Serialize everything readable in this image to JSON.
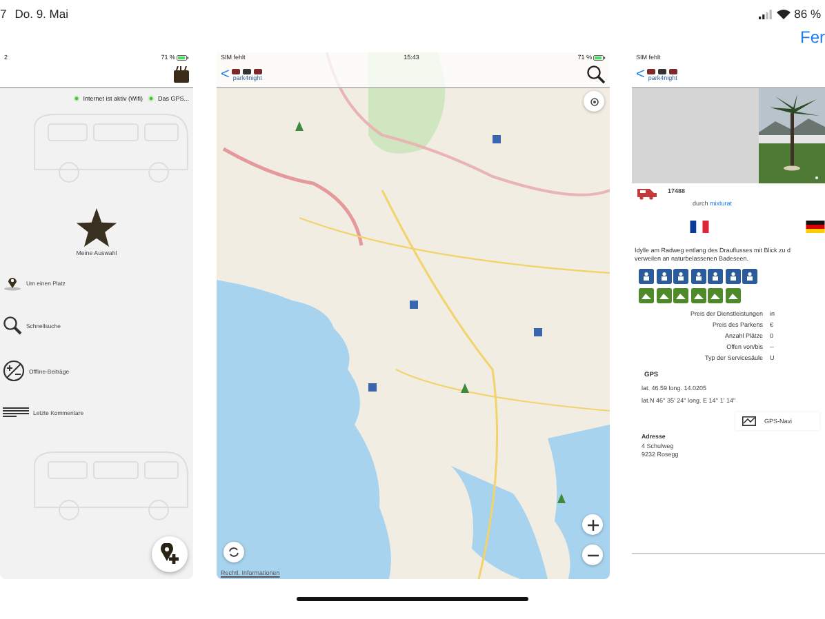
{
  "device_status": {
    "time": "7",
    "date": "Do. 9. Mai",
    "battery": "86 %"
  },
  "done_button": "Fer",
  "menu_screen": {
    "status": {
      "time": "2",
      "battery": "71 %"
    },
    "indicators": [
      {
        "label": "Internet ist aktiv (Wifi)",
        "on": true
      },
      {
        "label": "Das GPS...",
        "on": true
      }
    ],
    "favorite": "Meine Auswahl",
    "items": [
      {
        "kind": "nearby",
        "label": "Um einen Platz"
      },
      {
        "kind": "search",
        "label": "Schnellsuche"
      },
      {
        "kind": "offline",
        "label": "Offline-Beiträge"
      },
      {
        "kind": "comments",
        "label": "Letzte Kommentare"
      }
    ]
  },
  "map_screen": {
    "status": {
      "carrier": "SIM fehlt",
      "time": "15:43",
      "battery": "71 %"
    },
    "back_button": "<",
    "logo_text": "park4night",
    "legal_link": "Rechtl. Informationen"
  },
  "detail_screen": {
    "status": {
      "carrier": "SIM fehlt"
    },
    "back_button": "<",
    "logo_text": "park4night",
    "place_id": "17488",
    "author_prefix": "durch",
    "author": "mixturat",
    "languages": [
      {
        "kind": "fr"
      },
      {
        "kind": "de"
      }
    ],
    "description": [
      "Idylle am Radweg entlang des Drauflusses mit Blick zu d",
      "verweilen an naturbelassenen Badeseen."
    ],
    "services": [
      {
        "color": "#2b5c99"
      },
      {
        "color": "#2b5c99"
      },
      {
        "color": "#2b5c99"
      },
      {
        "color": "#2b5c99"
      },
      {
        "color": "#2b5c99"
      },
      {
        "color": "#2b5c99"
      },
      {
        "color": "#2b5c99"
      }
    ],
    "activities": [
      {
        "color": "#4f8a2a"
      },
      {
        "color": "#4f8a2a"
      },
      {
        "color": "#4f8a2a"
      },
      {
        "color": "#4f8a2a"
      },
      {
        "color": "#4f8a2a"
      },
      {
        "color": "#4f8a2a"
      }
    ],
    "attributes": [
      {
        "label": "Preis der Dienstleistungen",
        "value": "in"
      },
      {
        "label": "Preis des Parkens",
        "value": "€"
      },
      {
        "label": "Anzahl Plätze",
        "value": "0"
      },
      {
        "label": "Offen von/bis",
        "value": "--"
      },
      {
        "label": "Typ der Servicesäule",
        "value": "U"
      }
    ],
    "gps_title": "GPS",
    "coordinates": [
      "lat. 46.59 long. 14.0205",
      "lat.N 46° 35' 24\" long. E 14° 1' 14\""
    ],
    "navi_button": "GPS-Navi",
    "address_title": "Adresse",
    "address": [
      "4 Schulweg",
      "9232 Rosegg"
    ]
  }
}
